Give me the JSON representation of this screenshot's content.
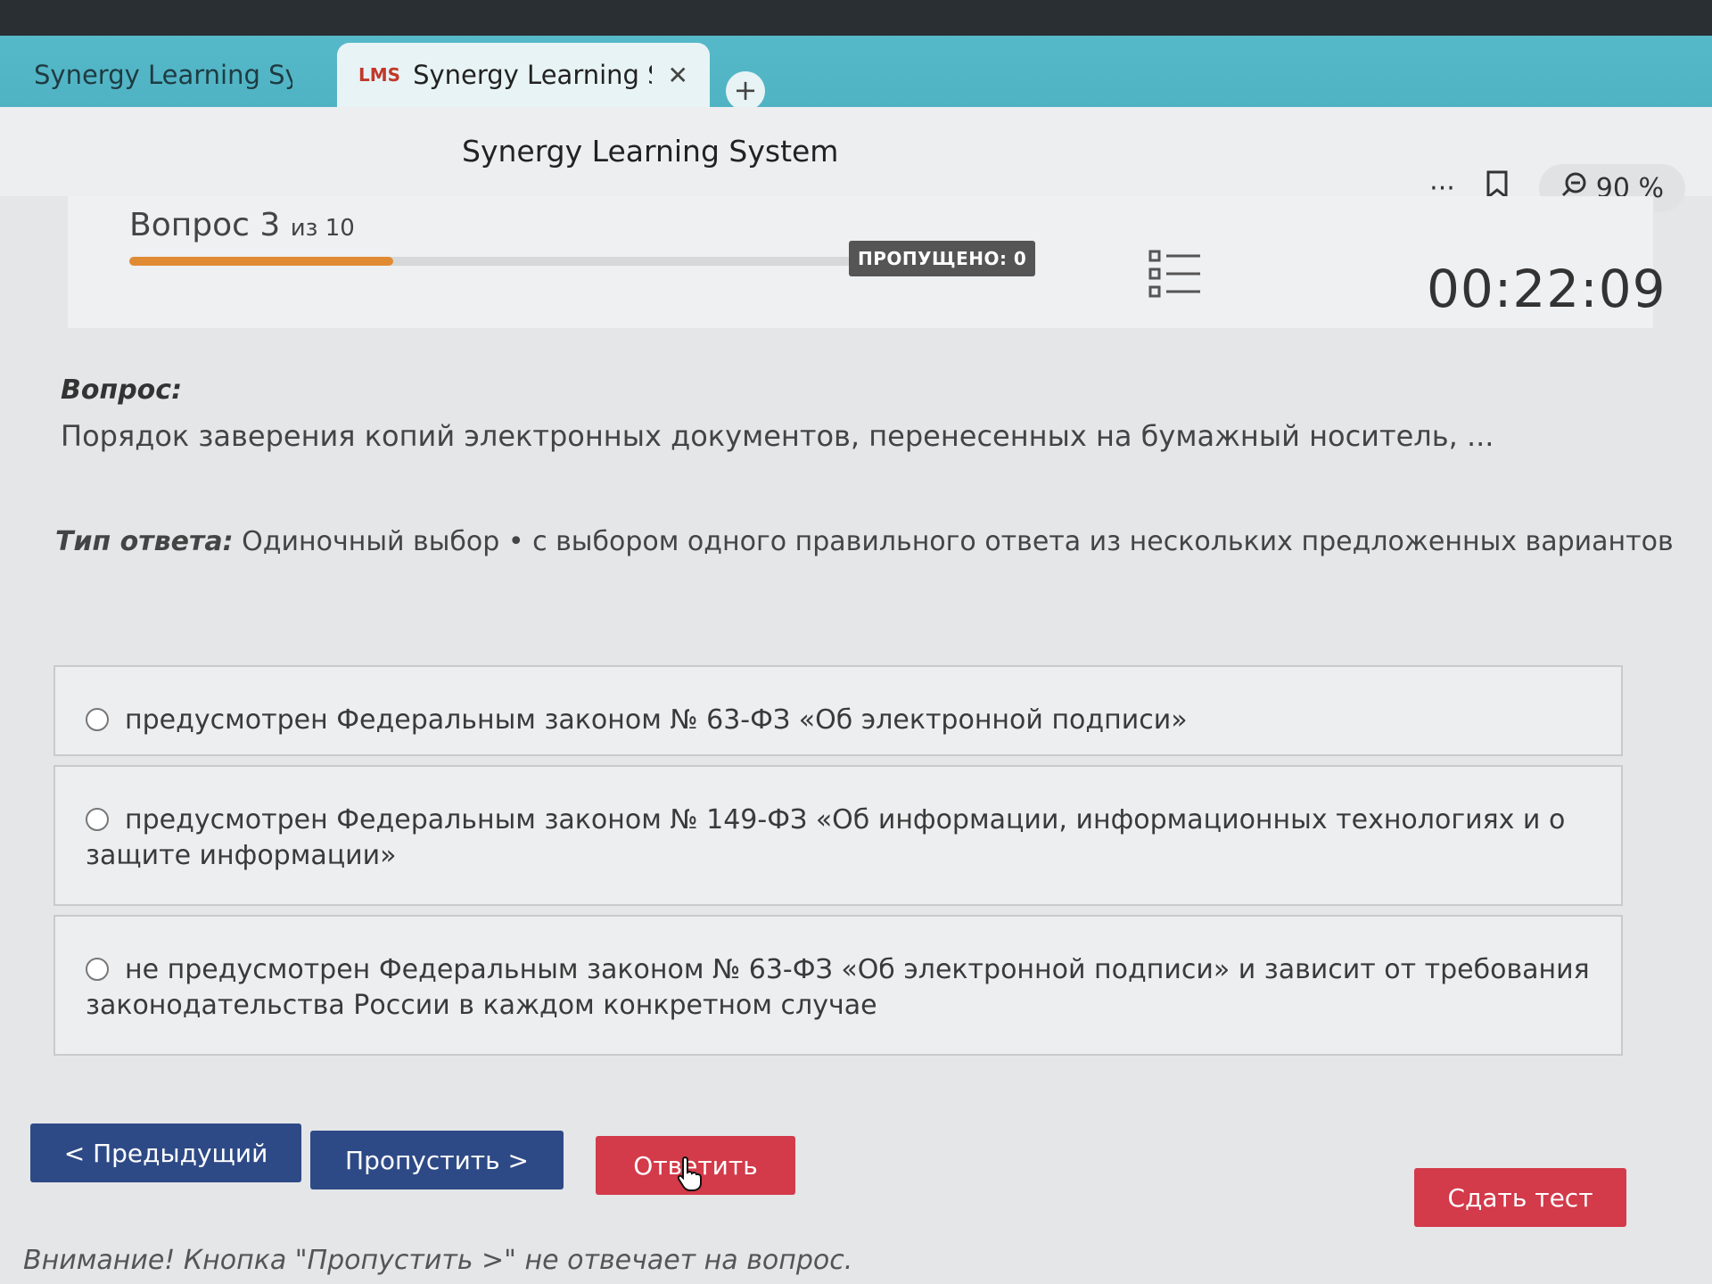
{
  "browser": {
    "tabs": [
      {
        "favicon": "",
        "label": "Synergy Learning System"
      },
      {
        "favicon": "LMS",
        "label": "Synergy Learning Syste"
      }
    ],
    "new_tab": "+",
    "close": "✕",
    "site_title": "Synergy Learning System",
    "more": "···",
    "zoom": "90 %"
  },
  "quiz": {
    "counter_main": "Вопрос 3",
    "counter_of": "из 10",
    "progress_fraction": 0.3,
    "skipped": "ПРОПУЩЕНО: 0",
    "timer": "00:22:09",
    "question_label": "Вопрос:",
    "question_text": "Порядок заверения копий электронных документов, перенесенных на бумажный носитель, ...",
    "answer_type_label": "Тип ответа:",
    "answer_type_value": "Одиночный выбор • с выбором одного правильного ответа из нескольких предложенных вариантов",
    "options": [
      "предусмотрен Федеральным законом № 63-ФЗ «Об электронной подписи»",
      "предусмотрен Федеральным законом № 149-ФЗ «Об информации, информационных технологиях и о защите информации»",
      "не предусмотрен Федеральным законом № 63-ФЗ «Об электронной подписи» и зависит от требования законодательства России в каждом конкретном случае"
    ],
    "buttons": {
      "prev": "< Предыдущий",
      "skip": "Пропустить >",
      "answer": "Ответить",
      "submit": "Сдать тест"
    },
    "warning": "Внимание! Кнопка \"Пропустить >\" не отвечает на вопрос."
  },
  "colors": {
    "progress": "#e18a34",
    "primary_button": "#2e4a86",
    "accent_button": "#d33a4a"
  }
}
